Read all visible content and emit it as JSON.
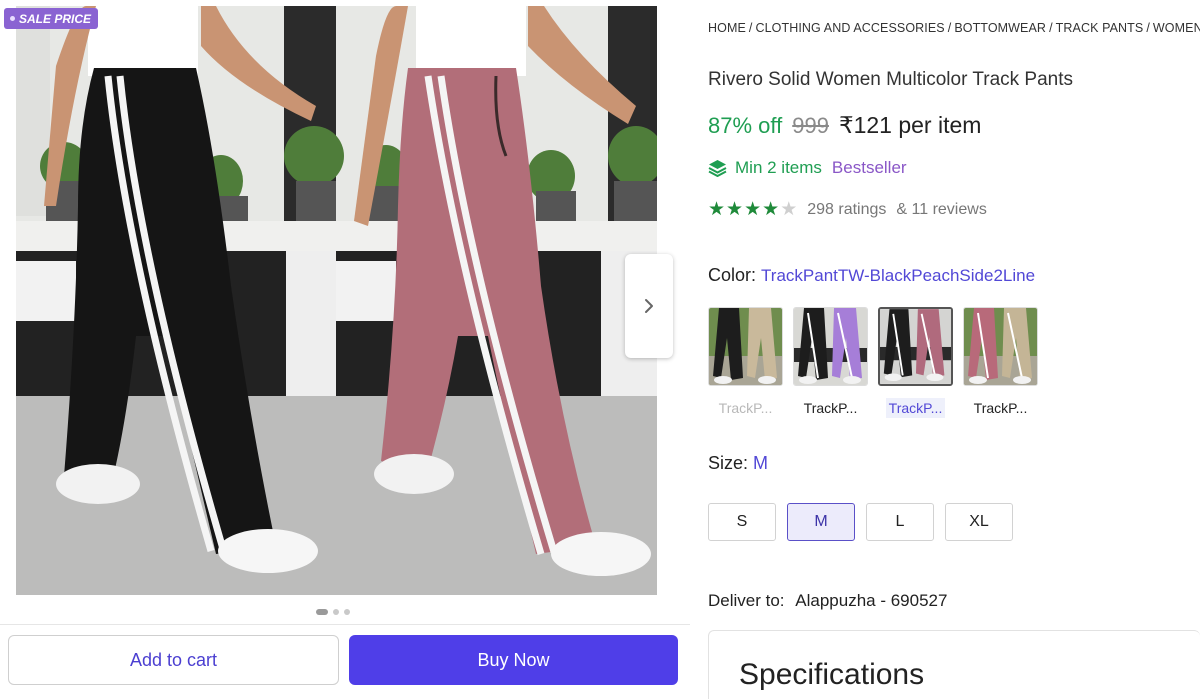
{
  "gallery": {
    "sale_badge": "SALE PRICE",
    "next_icon": "chevron-right-icon",
    "dots_count": 3,
    "active_dot": 1
  },
  "actions": {
    "add_to_cart": "Add to cart",
    "buy_now": "Buy Now"
  },
  "breadcrumb": [
    "HOME",
    "CLOTHING AND ACCESSORIES",
    "BOTTOMWEAR",
    "TRACK PANTS",
    "WOMEN'S"
  ],
  "product": {
    "title": "Rivero Solid Women Multicolor Track Pants",
    "discount": "87% off",
    "mrp": "999",
    "price": "₹121 per item",
    "min_items": "Min 2 items",
    "bestseller": "Bestseller",
    "rating_value": 4,
    "rating_max": 5,
    "ratings": "298 ratings",
    "reviews": "& 11 reviews"
  },
  "color": {
    "label": "Color:",
    "selected": "TrackPantTW-BlackPeachSide2Line",
    "swatches": [
      {
        "label": "TrackP...",
        "state": "faded",
        "colors": [
          "#1d1d1d",
          "#c9b99b"
        ]
      },
      {
        "label": "TrackP...",
        "state": "normal",
        "colors": [
          "#1d1d1d",
          "#a67ed8"
        ]
      },
      {
        "label": "TrackP...",
        "state": "selected",
        "colors": [
          "#1d1d1d",
          "#b06a7d"
        ]
      },
      {
        "label": "TrackP...",
        "state": "normal",
        "colors": [
          "#b86a7a",
          "#c4b596"
        ]
      }
    ]
  },
  "size": {
    "label": "Size:",
    "selected": "M",
    "options": [
      "S",
      "M",
      "L",
      "XL"
    ]
  },
  "delivery": {
    "label": "Deliver to:",
    "location": "Alappuzha - 690527"
  },
  "specifications": {
    "title": "Specifications"
  },
  "colors": {
    "accent": "#4f3ee8",
    "green": "#1f9e52",
    "purple_badge": "#8a63d2",
    "star": "#1f8a3a"
  }
}
